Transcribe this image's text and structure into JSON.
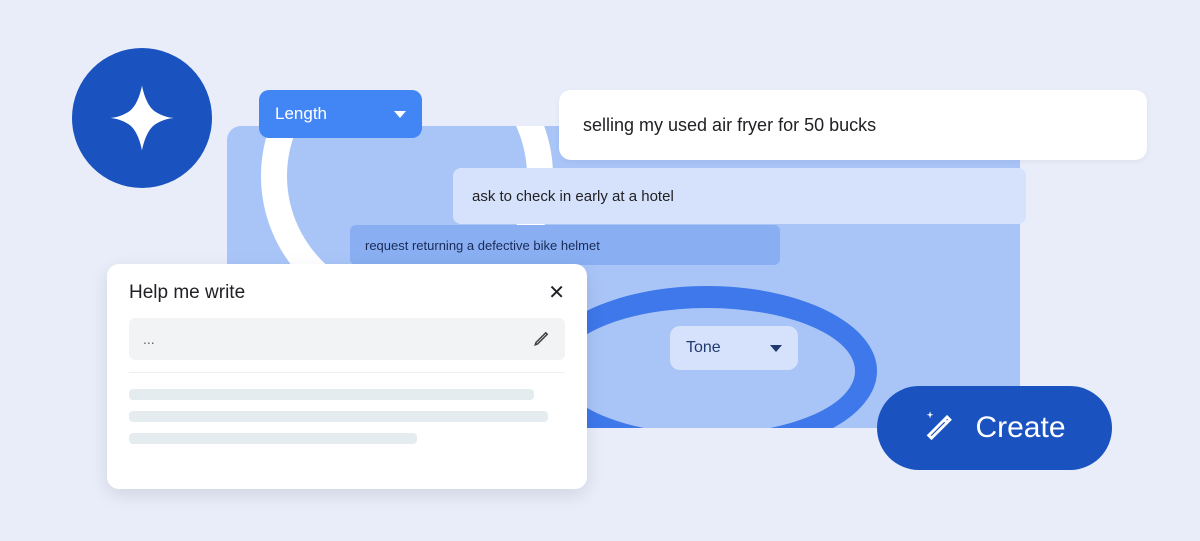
{
  "colors": {
    "page_bg": "#e8edf9",
    "accent_blue": "#4285f4",
    "dark_blue": "#1a52c0",
    "panel_blue": "#a9c5f7",
    "pale_blue": "#d6e2fb",
    "mid_blue": "#89aff2",
    "ring_stroke": "#3e78ea"
  },
  "logo_icon": "sparkle",
  "length_dropdown": {
    "label": "Length"
  },
  "tone_dropdown": {
    "label": "Tone"
  },
  "prompts": {
    "p1": "selling my used air fryer for 50 bucks",
    "p2": "ask to check in early at a hotel",
    "p3": "request returning a defective bike helmet"
  },
  "help_me_write": {
    "title": "Help me write",
    "close_glyph": "✕",
    "input_placeholder": "...",
    "edit_icon": "pencil"
  },
  "create_button": {
    "label": "Create",
    "icon": "magic-pen-sparkle"
  }
}
